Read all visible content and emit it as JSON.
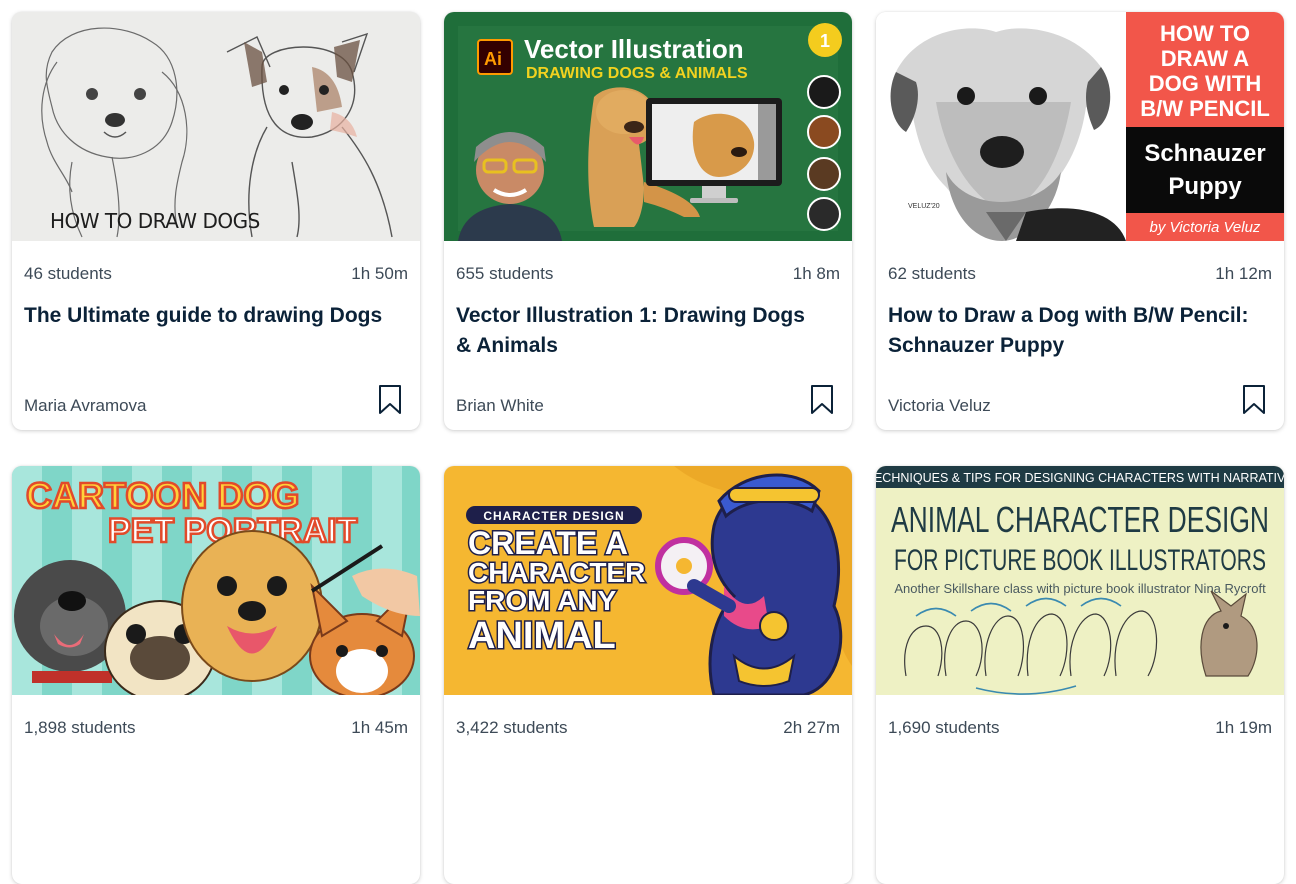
{
  "courses": [
    {
      "students": "46 students",
      "duration": "1h 50m",
      "title": "The Ultimate guide to drawing Dogs",
      "author": "Maria Avramova",
      "thumb_caption": "HOW TO DRAW DOGS"
    },
    {
      "students": "655 students",
      "duration": "1h 8m",
      "title": "Vector Illustration 1: Drawing Dogs & Animals",
      "author": "Brian White",
      "thumb_ai": "Ai",
      "thumb_title": "Vector Illustration",
      "thumb_subtitle": "DRAWING DOGS & ANIMALS",
      "thumb_badge": "1"
    },
    {
      "students": "62 students",
      "duration": "1h 12m",
      "title": "How to Draw a Dog with B/W Pencil: Schnauzer Puppy",
      "author": "Victoria Veluz",
      "thumb_lines": [
        "HOW TO",
        "DRAW A",
        "DOG WITH",
        "B/W PENCIL"
      ],
      "thumb_name1": "Schnauzer",
      "thumb_name2": "Puppy",
      "thumb_by": "by Victoria Veluz",
      "thumb_sig": "VELUZ'20"
    },
    {
      "students": "1,898 students",
      "duration": "1h 45m",
      "thumb_line1": "CARTOON DOG",
      "thumb_line2": "PET PORTRAIT"
    },
    {
      "students": "3,422 students",
      "duration": "2h 27m",
      "thumb_tag": "CHARACTER DESIGN",
      "thumb_lines": [
        "CREATE A",
        "CHARACTER",
        "FROM ANY",
        "ANIMAL"
      ]
    },
    {
      "students": "1,690 students",
      "duration": "1h 19m",
      "thumb_banner": "TECHNIQUES & TIPS FOR DESIGNING CHARACTERS WITH NARRATIVE",
      "thumb_line1": "ANIMAL CHARACTER DESIGN",
      "thumb_line2": "FOR PICTURE BOOK ILLUSTRATORS",
      "thumb_line3": "Another Skillshare class with picture book illustrator Nina Rycroft"
    }
  ]
}
